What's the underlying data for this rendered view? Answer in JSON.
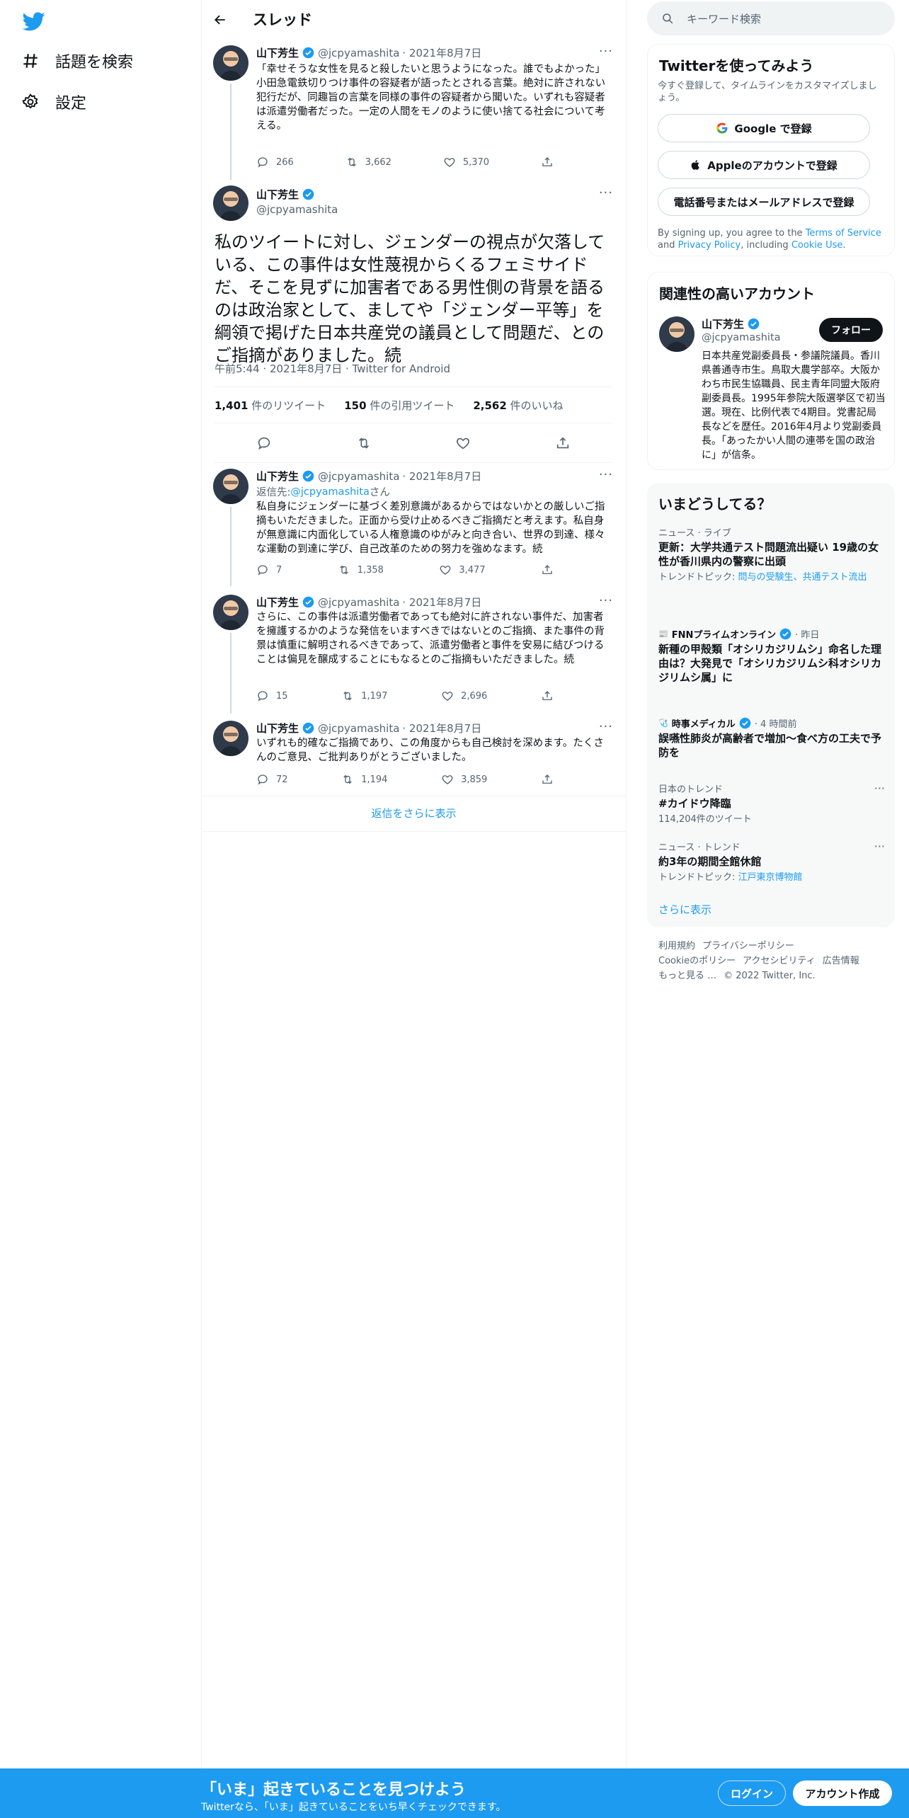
{
  "nav": {
    "explore_label": "話題を検索",
    "settings_label": "設定"
  },
  "header": {
    "title": "スレッド"
  },
  "tweets": [
    {
      "name": "山下芳生",
      "handle": "@jcpyamashita",
      "date": "· 2021年8月7日",
      "text": "「幸せそうな女性を見ると殺したいと思うようになった。誰でもよかった」\n小田急電鉄切りつけ事件の容疑者が語ったとされる言葉。絶対に許されない犯行だが、同趣旨の言葉を同様の事件の容疑者から聞いた。いずれも容疑者は派遣労働者だった。一定の人間をモノのように使い捨てる社会について考える。",
      "replies": "266",
      "retweets": "3,662",
      "likes": "5,370"
    },
    {
      "name": "山下芳生",
      "handle": "@jcpyamashita",
      "reply_prefix": "返信先: ",
      "reply_to": "@jcpyamashita",
      "reply_suffix": "さん",
      "text": "私自身にジェンダーに基づく差別意識があるからではないかとの厳しいご指摘もいただきました。正面から受け止めるべきご指摘だと考えます。私自身が無意識に内面化している人権意識のゆがみと向き合い、世界の到達、様々な運動の到達に学び、自己改革のための努力を強めなます。続",
      "date": "· 2021年8月7日",
      "replies": "7",
      "retweets": "1,358",
      "likes": "3,477"
    },
    {
      "name": "山下芳生",
      "handle": "@jcpyamashita",
      "date": "· 2021年8月7日",
      "text": "さらに、この事件は派遣労働者であっても絶対に許されない事件だ、加害者を擁護するかのような発信をいますべきではないとのご指摘、また事件の背景は慎重に解明されるべきであって、派遣労働者と事件を安易に結びつけることは偏見を醸成することにもなるとのご指摘もいただきました。続",
      "replies": "15",
      "retweets": "1,197",
      "likes": "2,696"
    },
    {
      "name": "山下芳生",
      "handle": "@jcpyamashita",
      "date": "· 2021年8月7日",
      "text": "いずれも的確なご指摘であり、この角度からも自己検討を深めます。たくさんのご意見、ご批判ありがとうございました。",
      "replies": "72",
      "retweets": "1,194",
      "likes": "3,859"
    }
  ],
  "focus": {
    "name": "山下芳生",
    "handle": "@jcpyamashita",
    "text": "私のツイートに対し、ジェンダーの視点が欠落している、この事件は女性蔑視からくるフェミサイドだ、そこを見ずに加害者である男性側の背景を語るのは政治家として、ましてや「ジェンダー平等」を綱領で掲げた日本共産党の議員として問題だ、とのご指摘がありました。続",
    "meta": "午前5:44 · 2021年8月7日 · Twitter for Android",
    "retweets_count": "1,401",
    "retweets_label": " 件のリツイート",
    "quotes_count": "150",
    "quotes_label": " 件の引用ツイート",
    "likes_count": "2,562",
    "likes_label": " 件のいいね"
  },
  "show_more_replies": "返信をさらに表示",
  "sidebar": {
    "search_placeholder": "キーワード検索",
    "signup": {
      "title": "Twitterを使ってみよう",
      "subtitle": "今すぐ登録して、タイムラインをカスタマイズしましょう。",
      "google": "Google で登録",
      "apple": "Appleのアカウントで登録",
      "phone": "電話番号またはメールアドレスで登録",
      "terms_pre": "By signing up, you agree to the ",
      "terms_link": "Terms of Service",
      "terms_and": " and ",
      "privacy_link": "Privacy Policy",
      "terms_mid": ", including ",
      "cookie_link": "Cookie Use",
      "terms_end": "."
    },
    "related": {
      "title": "関連性の高いアカウント",
      "name": "山下芳生",
      "handle": "@jcpyamashita",
      "follow": "フォロー",
      "bio": "日本共産党副委員長・参議院議員。香川県善通寺市生。鳥取大農学部卒。大阪かわち市民生協職員、民主青年同盟大阪府副委員長。1995年参院大阪選挙区で初当選。現在、比例代表で4期目。党書記局長などを歴任。2016年4月より党副委員長。「あったかい人間の連帯を国の政治に」が信条。"
    },
    "trends": {
      "title": "いまどうしてる？",
      "items": [
        {
          "context": "ニュース · ライブ",
          "title": "更新：大学共通テスト問題流出疑い 19歳の女性が香川県内の警察に出頭",
          "sub_pre": "トレンドトピック: ",
          "sub_link": "問与の受験生、共通テスト流出"
        },
        {
          "context": "FNNプライムオンライン",
          "context_time": " · 昨日",
          "title": "新種の甲殻類「オシリカジリムシ」命名した理由は？大発見で「オシリカジリムシ科オシリカジリムシ属」に"
        },
        {
          "context": "時事メディカル",
          "context_time": " · 4 時間前",
          "title": "誤嚥性肺炎が高齢者で増加～食べ方の工夫で予防を"
        },
        {
          "context": "日本のトレンド",
          "title": "#カイドウ降臨",
          "sub": "114,204件のツイート"
        },
        {
          "context": "ニュース · トレンド",
          "title": "約3年の期間全館休館",
          "sub_pre": "トレンドトピック: ",
          "sub_link": "江戸東京博物館"
        }
      ],
      "show_more": "さらに表示"
    },
    "footer": [
      "利用規約",
      "プライバシーポリシー",
      "Cookieのポリシー",
      "アクセシビリティ",
      "広告情報",
      "もっと見る …",
      "© 2022 Twitter, Inc."
    ]
  },
  "bottom_bar": {
    "title": "「いま」起きていることを見つけよう",
    "subtitle": "Twitterなら、「いま」起きていることをいち早くチェックできます。",
    "login": "ログイン",
    "signup": "アカウント作成"
  },
  "colors": {
    "accent": "#1d9bf0",
    "text": "#0f1419",
    "muted": "#536471"
  }
}
